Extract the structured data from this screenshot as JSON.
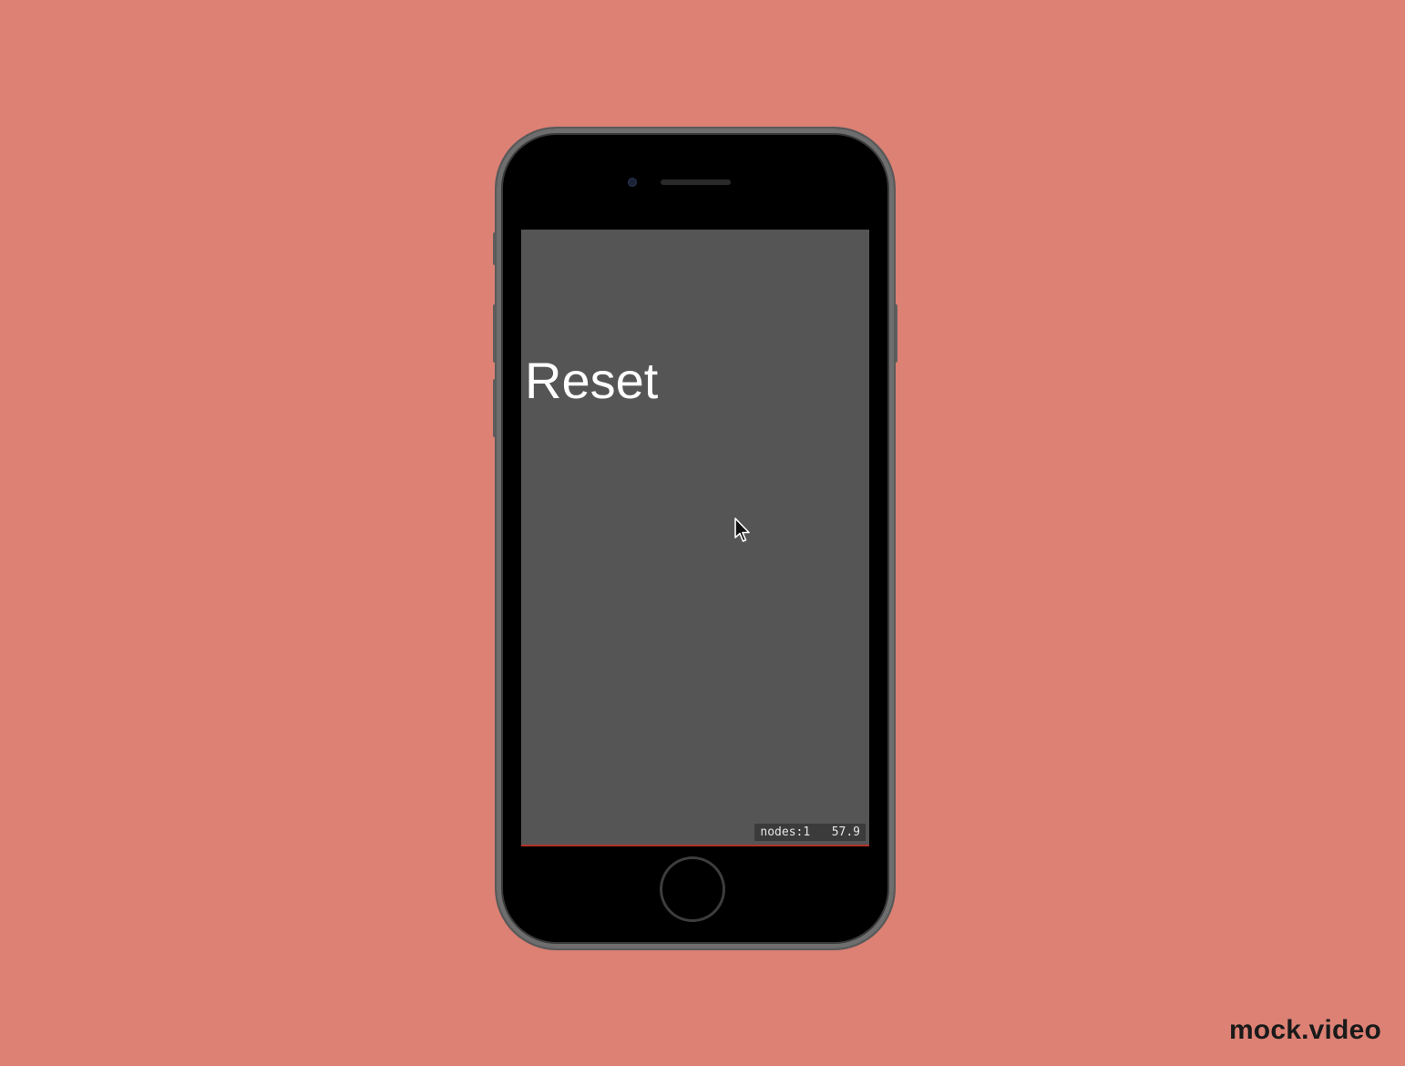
{
  "screen": {
    "reset_label": "Reset",
    "stats": {
      "nodes": "nodes:1",
      "fps": "57.9"
    }
  },
  "watermark": "mock.video",
  "colors": {
    "background": "#dc8174",
    "screen": "#555555",
    "text": "#ffffff"
  },
  "icons": {
    "cursor": "mouse-pointer-icon",
    "home": "home-button-icon"
  }
}
